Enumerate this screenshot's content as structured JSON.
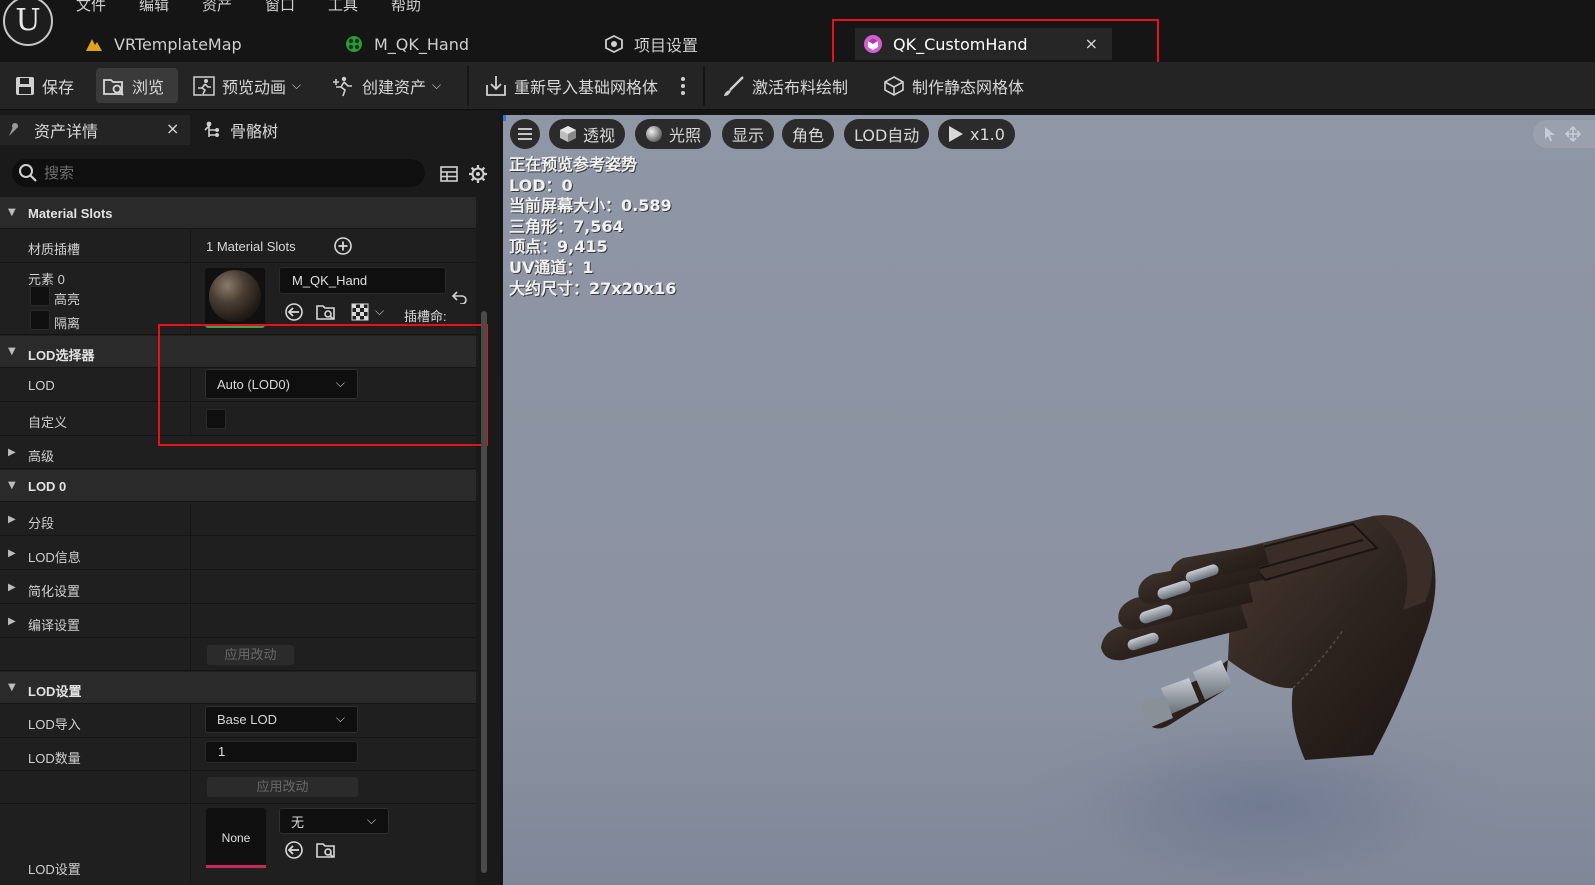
{
  "menu": [
    "文件",
    "编辑",
    "资产",
    "窗口",
    "工具",
    "帮助"
  ],
  "tabs": [
    {
      "label": "VRTemplateMap",
      "icon": "level-icon"
    },
    {
      "label": "M_QK_Hand",
      "icon": "material-icon"
    },
    {
      "label": "项目设置",
      "icon": "settings-cube-icon"
    },
    {
      "label": "QK_CustomHand",
      "icon": "skeletal-mesh-icon",
      "close": "×"
    }
  ],
  "toolbar": {
    "save": "保存",
    "browse": "浏览",
    "preview_anim": "预览动画",
    "create_asset": "创建资产",
    "reimport": "重新导入基础网格体",
    "cloth_paint": "激活布料绘制",
    "make_static": "制作静态网格体"
  },
  "left_panel": {
    "tab_details": "资产详情",
    "tab_close": "×",
    "tab_skeleton": "骨骼树",
    "search_placeholder": "搜索"
  },
  "details": {
    "material_slots_header": "Material Slots",
    "material_slots_label": "材质插槽",
    "material_slots_count": "1 Material Slots",
    "element0": "元素 0",
    "highlight": "高亮",
    "isolate": "隔离",
    "material_name": "M_QK_Hand",
    "slot_name_trunc": "插槽命:",
    "lod_picker_header": "LOD选择器",
    "lod_label": "LOD",
    "lod_value": "Auto (LOD0)",
    "custom_label": "自定义",
    "advanced": "高级",
    "lod0_header": "LOD 0",
    "sections": "分段",
    "lod_info": "LOD信息",
    "reduction": "简化设置",
    "build_settings": "编译设置",
    "apply_changes": "应用改动",
    "lod_settings_header": "LOD设置",
    "lod_import_label": "LOD导入",
    "lod_import_value": "Base LOD",
    "lod_count_label": "LOD数量",
    "lod_count_value": "1",
    "apply_changes2": "应用改动",
    "lod_settings_label": "LOD设置",
    "none_thumb": "None",
    "none_dropdown": "无"
  },
  "viewport": {
    "perspective": "透视",
    "lit": "光照",
    "show": "显示",
    "character": "角色",
    "lod_auto": "LOD自动",
    "speed": "x1.0",
    "stats": [
      "正在预览参考姿势",
      "LOD：0",
      "当前屏幕大小：0.589",
      "三角形：7,564",
      "顶点：9,415",
      "UV通道：1",
      "大约尺寸：27x20x16"
    ]
  },
  "colors": {
    "highlight_box": "#e5121c",
    "viewport_bg": "#8f96a6",
    "thumb_bar_green": "#3fa34d",
    "thumb_bar_pink": "#c72a5a"
  }
}
